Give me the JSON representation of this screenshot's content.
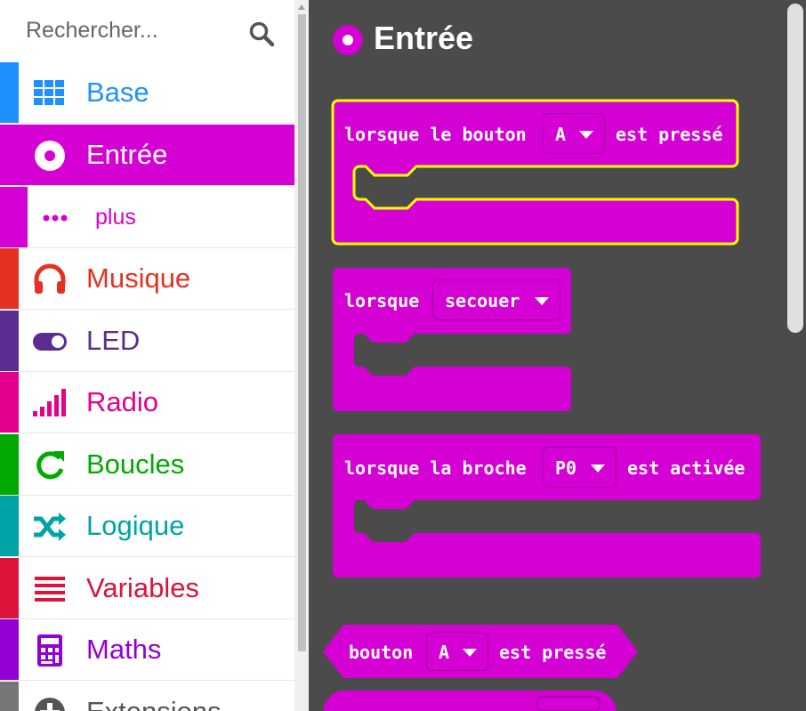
{
  "search": {
    "placeholder": "Rechercher...",
    "icon": "search-icon"
  },
  "sidebar": {
    "items": [
      {
        "label": "Base",
        "color": "#1e90ff",
        "icon": "grid-icon"
      },
      {
        "label": "Entrée",
        "color": "#d400d4",
        "icon": "record-icon",
        "selected": true
      },
      {
        "label": "plus",
        "color": "#d400d4",
        "icon": "more-icon",
        "sub": true
      },
      {
        "label": "Musique",
        "color": "#e63022",
        "icon": "headphones-icon"
      },
      {
        "label": "LED",
        "color": "#5c2d91",
        "icon": "toggle-icon"
      },
      {
        "label": "Radio",
        "color": "#e3008c",
        "icon": "signal-icon"
      },
      {
        "label": "Boucles",
        "color": "#00aa00",
        "icon": "refresh-icon"
      },
      {
        "label": "Logique",
        "color": "#00a4a6",
        "icon": "shuffle-icon"
      },
      {
        "label": "Variables",
        "color": "#dc143c",
        "icon": "list-icon"
      },
      {
        "label": "Maths",
        "color": "#9400d3",
        "icon": "calculator-icon"
      },
      {
        "label": "Extensions",
        "color": "#777777",
        "icon": "plus-circle-icon"
      }
    ]
  },
  "workspace": {
    "title": "Entrée",
    "title_icon": "record-icon",
    "block_color": "#d400d4",
    "highlight_color": "#ffff00",
    "blocks": {
      "button_pressed": {
        "text_1": "lorsque le bouton",
        "dropdown": "A",
        "text_2": "est pressé"
      },
      "gesture": {
        "text_1": "lorsque",
        "dropdown": "secouer"
      },
      "pin_pressed": {
        "text_1": "lorsque la broche",
        "dropdown": "P0",
        "text_2": "est activée"
      },
      "button_is_pressed": {
        "text_1": "bouton",
        "dropdown": "A",
        "text_2": "est pressé"
      }
    }
  }
}
